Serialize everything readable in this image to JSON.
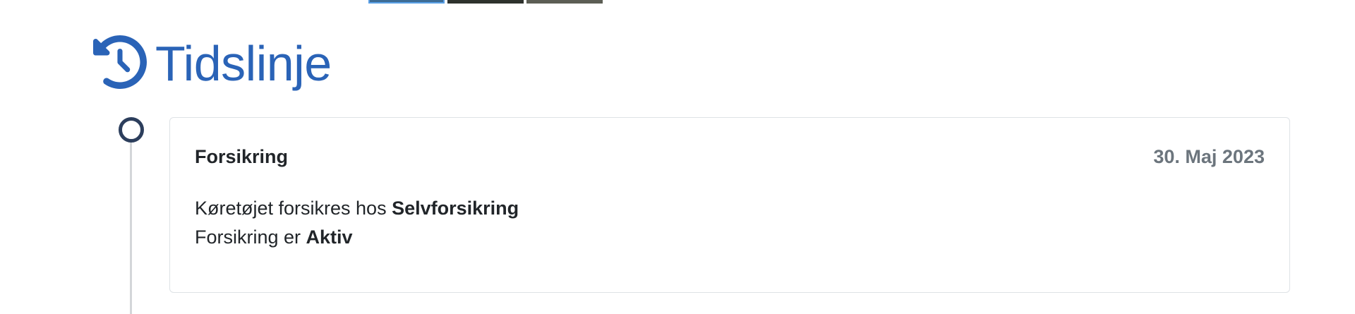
{
  "gallery": {
    "thumbnails": [
      {
        "name": "thumbnail-1",
        "selected": true
      },
      {
        "name": "thumbnail-2",
        "selected": false
      },
      {
        "name": "thumbnail-3",
        "selected": false
      }
    ]
  },
  "timeline_section": {
    "icon": "history-icon",
    "title": "Tidslinje",
    "accent_color": "#2a63b7"
  },
  "events": [
    {
      "title": "Forsikring",
      "date": "30. Maj 2023",
      "line1_prefix": "Køretøjet forsikres hos ",
      "line1_value": "Selvforsikring",
      "line2_prefix": "Forsikring er ",
      "line2_value": "Aktiv"
    }
  ]
}
